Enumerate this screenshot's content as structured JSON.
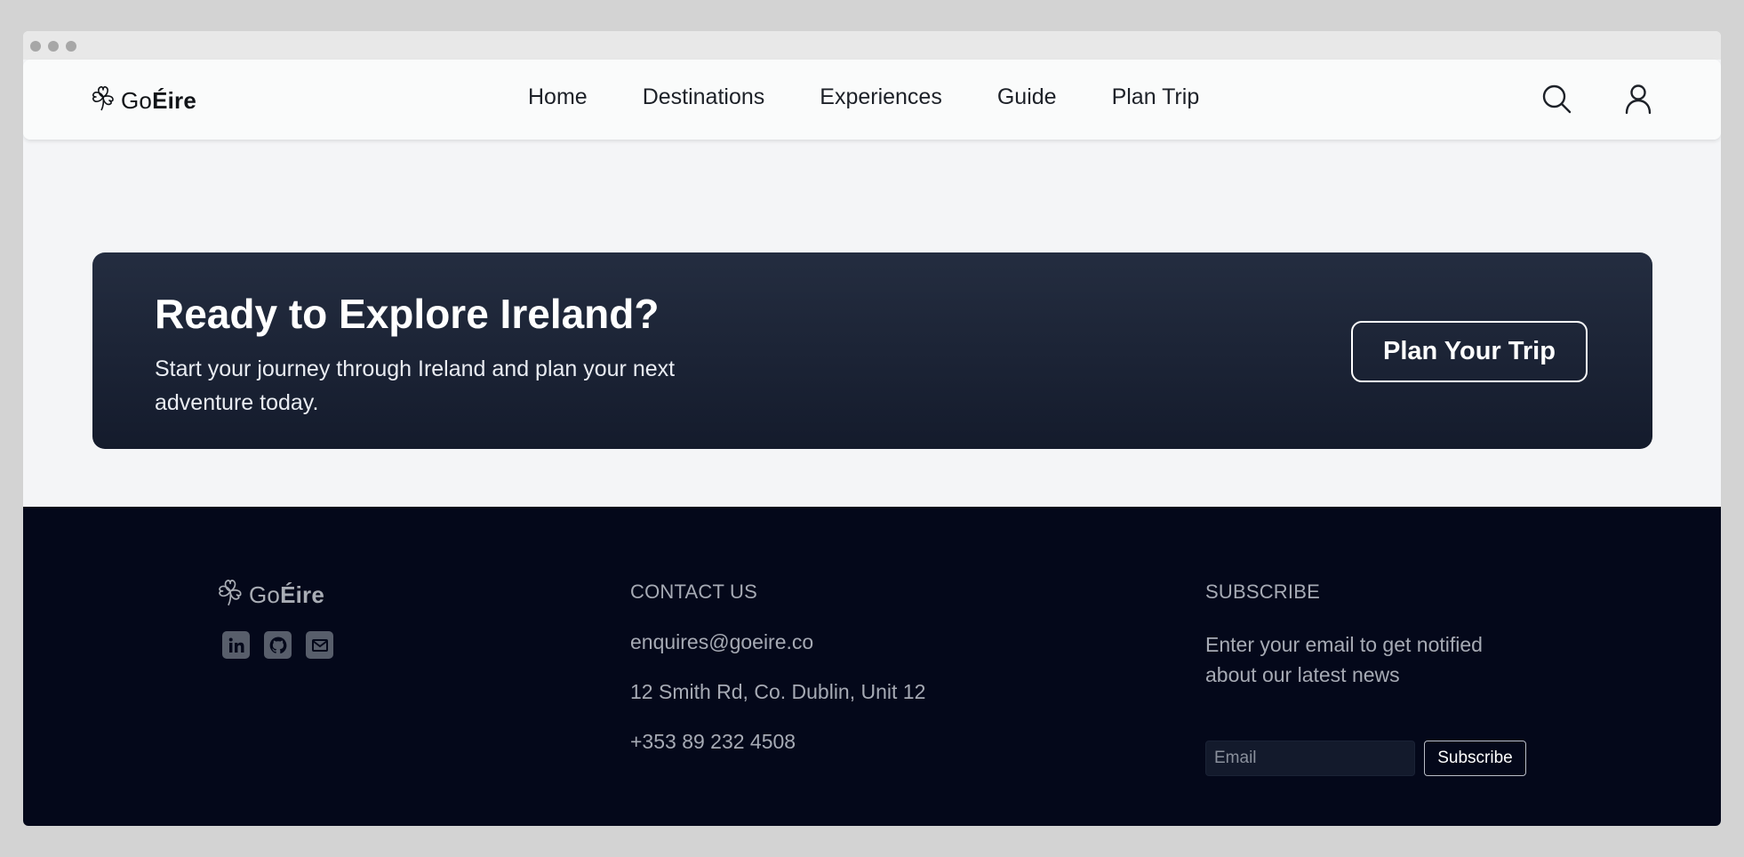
{
  "brand": {
    "prefix": "Go",
    "suffix": "Éire"
  },
  "nav": {
    "links": [
      "Home",
      "Destinations",
      "Experiences",
      "Guide",
      "Plan Trip"
    ],
    "icons": [
      "search-icon",
      "user-icon"
    ]
  },
  "cta": {
    "title": "Ready to Explore Ireland?",
    "subtitle": "Start your journey through Ireland and plan your next adventure today.",
    "button": "Plan Your Trip"
  },
  "footer": {
    "socials": [
      "linkedin-icon",
      "github-icon",
      "mail-icon"
    ],
    "contact": {
      "heading": "CONTACT US",
      "email": "enquires@goeire.co",
      "address": "12 Smith Rd, Co. Dublin, Unit 12",
      "phone": "+353 89 232 4508"
    },
    "subscribe": {
      "heading": "SUBSCRIBE",
      "text": "Enter your email to get notified about our latest news",
      "placeholder": "Email",
      "button": "Subscribe"
    }
  },
  "colors": {
    "page_bg": "#f4f5f7",
    "cta_bg": "#1c2436",
    "footer_bg": "#04081a",
    "footer_text": "#a6aab4"
  }
}
